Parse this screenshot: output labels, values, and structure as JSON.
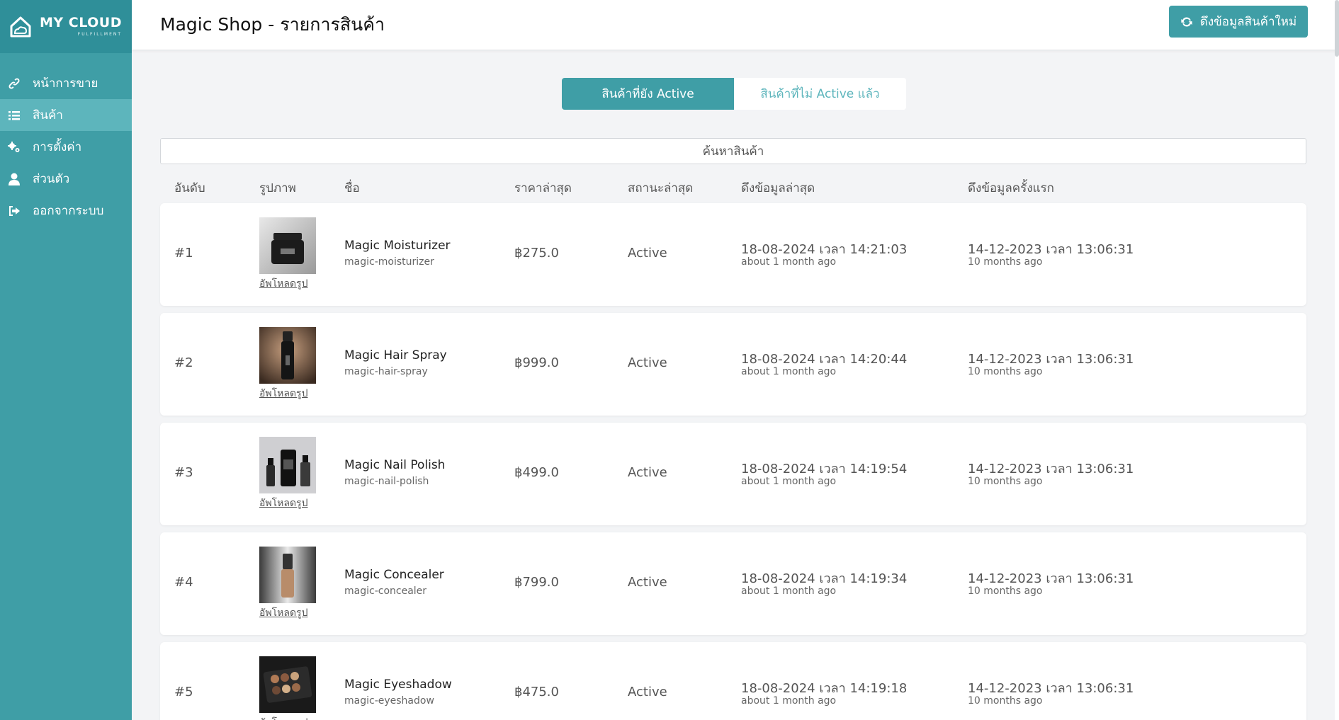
{
  "brand": {
    "name": "MY CLOUD",
    "sub": "FULFILLMENT"
  },
  "sidebar": {
    "items": [
      {
        "label": "หน้าการขาย",
        "icon": "link-icon"
      },
      {
        "label": "สินค้า",
        "icon": "list-icon",
        "active": true
      },
      {
        "label": "การตั้งค่า",
        "icon": "gears-icon"
      },
      {
        "label": "ส่วนตัว",
        "icon": "user-icon"
      },
      {
        "label": "ออกจากระบบ",
        "icon": "sign-out-icon"
      }
    ]
  },
  "header": {
    "title": "Magic Shop - รายการสินค้า",
    "refresh_label": "ดึงข้อมูลสินค้าใหม่"
  },
  "tabs": {
    "active": "สินค้าที่ยัง Active",
    "inactive": "สินค้าที่ไม่ Active แล้ว"
  },
  "search": {
    "placeholder": "ค้นหาสินค้า"
  },
  "columns": {
    "rank": "อันดับ",
    "image": "รูปภาพ",
    "name": "ชื่อ",
    "price": "ราคาล่าสุด",
    "status": "สถานะล่าสุด",
    "last_fetch": "ดึงข้อมูลล่าสุด",
    "first_fetch": "ดึงข้อมูลครั้งแรก"
  },
  "upload_label": "อัพโหลดรูป",
  "products": [
    {
      "rank": "#1",
      "name": "Magic Moisturizer",
      "slug": "magic-moisturizer",
      "price": "฿275.0",
      "status": "Active",
      "last": "18-08-2024 เวลา 14:21:03",
      "last_rel": "about 1 month ago",
      "first": "14-12-2023 เวลา 13:06:31",
      "first_rel": "10 months ago"
    },
    {
      "rank": "#2",
      "name": "Magic Hair Spray",
      "slug": "magic-hair-spray",
      "price": "฿999.0",
      "status": "Active",
      "last": "18-08-2024 เวลา 14:20:44",
      "last_rel": "about 1 month ago",
      "first": "14-12-2023 เวลา 13:06:31",
      "first_rel": "10 months ago"
    },
    {
      "rank": "#3",
      "name": "Magic Nail Polish",
      "slug": "magic-nail-polish",
      "price": "฿499.0",
      "status": "Active",
      "last": "18-08-2024 เวลา 14:19:54",
      "last_rel": "about 1 month ago",
      "first": "14-12-2023 เวลา 13:06:31",
      "first_rel": "10 months ago"
    },
    {
      "rank": "#4",
      "name": "Magic Concealer",
      "slug": "magic-concealer",
      "price": "฿799.0",
      "status": "Active",
      "last": "18-08-2024 เวลา 14:19:34",
      "last_rel": "about 1 month ago",
      "first": "14-12-2023 เวลา 13:06:31",
      "first_rel": "10 months ago"
    },
    {
      "rank": "#5",
      "name": "Magic Eyeshadow",
      "slug": "magic-eyeshadow",
      "price": "฿475.0",
      "status": "Active",
      "last": "18-08-2024 เวลา 14:19:18",
      "last_rel": "about 1 month ago",
      "first": "14-12-2023 เวลา 13:06:31",
      "first_rel": "10 months ago"
    }
  ],
  "colors": {
    "accent": "#3f9ea6",
    "sidebar": "#3f9ea6",
    "sidebar_active": "#5db5bc"
  }
}
